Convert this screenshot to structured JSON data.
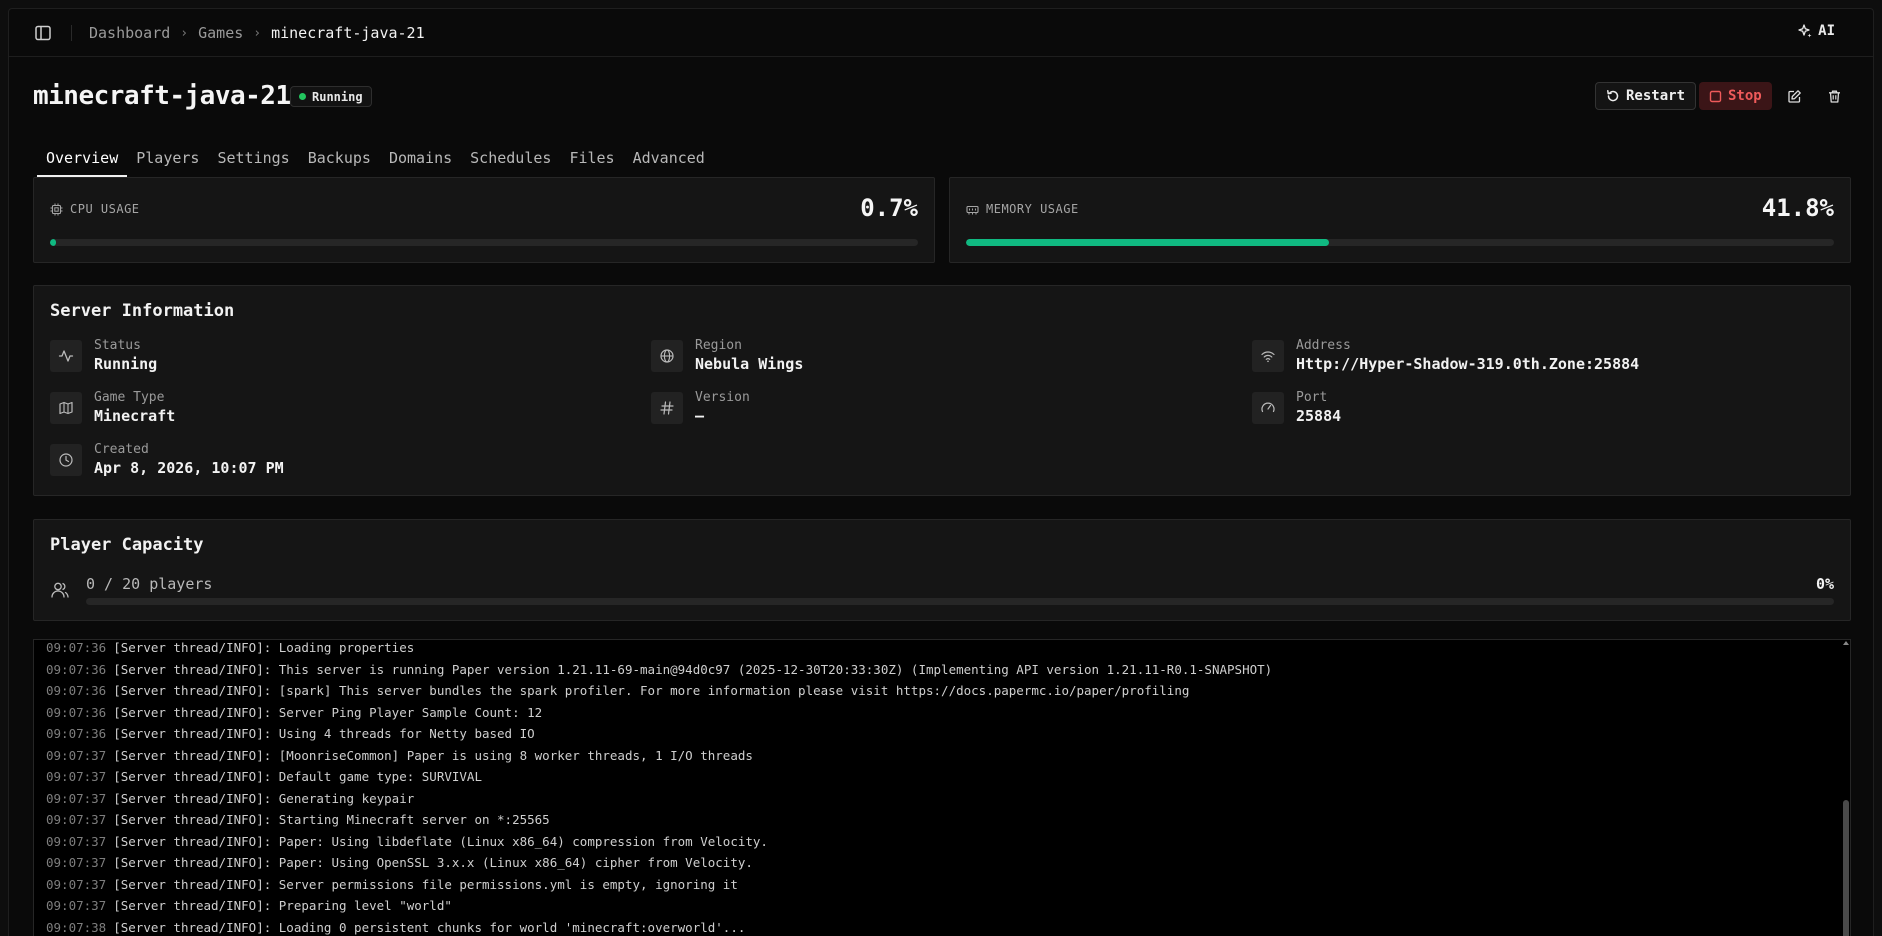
{
  "breadcrumb": {
    "items": [
      "Dashboard",
      "Games"
    ],
    "current": "minecraft-java-21"
  },
  "topbar": {
    "ai_label": "AI"
  },
  "header": {
    "title": "minecraft-java-21",
    "status": "Running",
    "status_color": "#22c55e",
    "restart_label": "Restart",
    "stop_label": "Stop"
  },
  "tabs": [
    "Overview",
    "Players",
    "Settings",
    "Backups",
    "Domains",
    "Schedules",
    "Files",
    "Advanced"
  ],
  "active_tab": "Overview",
  "metrics": {
    "cpu": {
      "label": "CPU USAGE",
      "value": "0.7%",
      "fraction": 0.007
    },
    "memory": {
      "label": "MEMORY USAGE",
      "value": "41.8%",
      "fraction": 0.418
    }
  },
  "server_info": {
    "title": "Server Information",
    "items": [
      {
        "label": "Status",
        "value": "Running",
        "icon": "activity-icon"
      },
      {
        "label": "Region",
        "value": "Nebula Wings",
        "icon": "globe-icon"
      },
      {
        "label": "Address",
        "value": "Http://Hyper-Shadow-319.0th.Zone:25884",
        "icon": "wifi-icon"
      },
      {
        "label": "Game Type",
        "value": "Minecraft",
        "icon": "map-icon"
      },
      {
        "label": "Version",
        "value": "—",
        "icon": "hash-icon"
      },
      {
        "label": "Port",
        "value": "25884",
        "icon": "gauge-icon"
      },
      {
        "label": "Created",
        "value": "Apr 8, 2026, 10:07 PM",
        "icon": "clock-icon"
      }
    ]
  },
  "capacity": {
    "title": "Player Capacity",
    "text": "0 / 20 players",
    "percent": "0%",
    "fraction": 0
  },
  "accent_color": "#10b981",
  "console": {
    "lines": [
      {
        "time": "09:07:36",
        "msg": "[Server thread/INFO]: Loading properties"
      },
      {
        "time": "09:07:36",
        "msg": "[Server thread/INFO]: This server is running Paper version 1.21.11-69-main@94d0c97 (2025-12-30T20:33:30Z) (Implementing API version 1.21.11-R0.1-SNAPSHOT)"
      },
      {
        "time": "09:07:36",
        "msg": "[Server thread/INFO]: [spark] This server bundles the spark profiler. For more information please visit https://docs.papermc.io/paper/profiling"
      },
      {
        "time": "09:07:36",
        "msg": "[Server thread/INFO]: Server Ping Player Sample Count: 12"
      },
      {
        "time": "09:07:36",
        "msg": "[Server thread/INFO]: Using 4 threads for Netty based IO"
      },
      {
        "time": "09:07:37",
        "msg": "[Server thread/INFO]: [MoonriseCommon] Paper is using 8 worker threads, 1 I/O threads"
      },
      {
        "time": "09:07:37",
        "msg": "[Server thread/INFO]: Default game type: SURVIVAL"
      },
      {
        "time": "09:07:37",
        "msg": "[Server thread/INFO]: Generating keypair"
      },
      {
        "time": "09:07:37",
        "msg": "[Server thread/INFO]: Starting Minecraft server on *:25565"
      },
      {
        "time": "09:07:37",
        "msg": "[Server thread/INFO]: Paper: Using libdeflate (Linux x86_64) compression from Velocity."
      },
      {
        "time": "09:07:37",
        "msg": "[Server thread/INFO]: Paper: Using OpenSSL 3.x.x (Linux x86_64) cipher from Velocity."
      },
      {
        "time": "09:07:37",
        "msg": "[Server thread/INFO]: Server permissions file permissions.yml is empty, ignoring it"
      },
      {
        "time": "09:07:37",
        "msg": "[Server thread/INFO]: Preparing level \"world\""
      },
      {
        "time": "09:07:38",
        "msg": "[Server thread/INFO]: Loading 0 persistent chunks for world 'minecraft:overworld'..."
      }
    ]
  }
}
